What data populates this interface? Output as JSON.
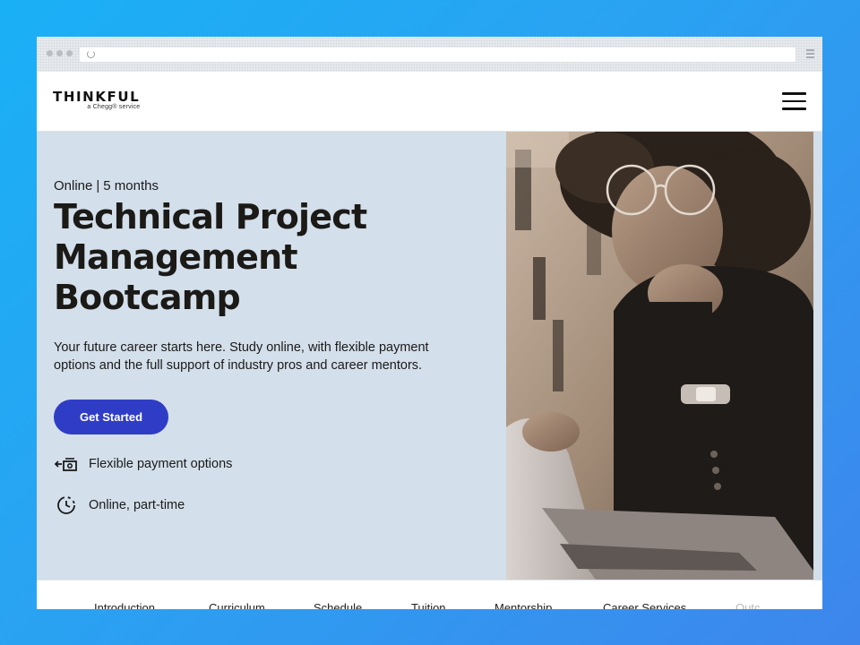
{
  "brand": {
    "name": "THINKFUL",
    "tagline": "a Chegg® service"
  },
  "hero": {
    "eyebrow_left": "Online",
    "eyebrow_sep": "|",
    "eyebrow_right": "5 months",
    "headline_line1": "Technical Project",
    "headline_line2": "Management",
    "headline_line3": "Bootcamp",
    "subcopy": "Your future career starts here. Study online, with flexible payment options and the full support of industry pros and career mentors.",
    "cta_label": "Get Started",
    "features": [
      {
        "label": "Flexible payment options",
        "icon": "payment-icon"
      },
      {
        "label": "Online, part-time",
        "icon": "clock-icon"
      }
    ]
  },
  "subnav": {
    "items": [
      "Introduction",
      "Curriculum",
      "Schedule",
      "Tuition",
      "Mentorship",
      "Career Services",
      "Outc"
    ]
  },
  "colors": {
    "background_gradient_start": "#1ab0f6",
    "background_gradient_end": "#3d86ec",
    "hero_bg": "#d3dfea",
    "cta_bg": "#2f3dc6",
    "heading": "#1b1a17"
  }
}
